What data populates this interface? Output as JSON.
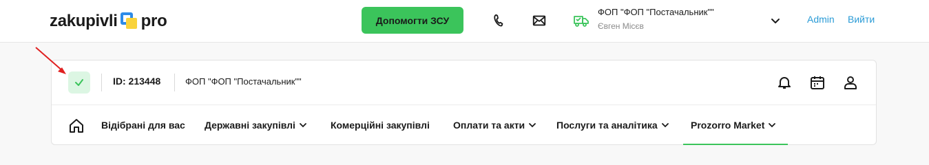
{
  "header": {
    "logo_left": "zakupivli",
    "logo_right": "pro",
    "help_button": "Допомогти ЗСУ",
    "org_name": "ФОП \"ФОП \"Постачальник\"\"",
    "person_name": "Євген Місєв",
    "admin_link": "Admin",
    "logout_link": "Вийти",
    "icons": [
      "phone-icon",
      "mail-icon",
      "truck-icon",
      "chevron-down-icon"
    ]
  },
  "account": {
    "id_label": "ID: 213448",
    "org_name": "ФОП \"ФОП \"Постачальник\"\"",
    "status_icon": "check-icon",
    "icons": [
      "bell-icon",
      "calendar-icon",
      "user-icon"
    ]
  },
  "nav": {
    "items": [
      {
        "label": "Відібрані для вас",
        "dropdown": false
      },
      {
        "label": "Державні закупівлі",
        "dropdown": true
      },
      {
        "label": "Комерційні закупівлі",
        "dropdown": false
      },
      {
        "label": "Оплати та акти",
        "dropdown": true
      },
      {
        "label": "Послуги та аналітика",
        "dropdown": true
      },
      {
        "label": "Prozorro Market",
        "dropdown": true
      }
    ],
    "active_index": 5
  },
  "colors": {
    "accent_green": "#3bc45b",
    "link_blue": "#2a9bd6",
    "annotation_red": "#e02020"
  }
}
